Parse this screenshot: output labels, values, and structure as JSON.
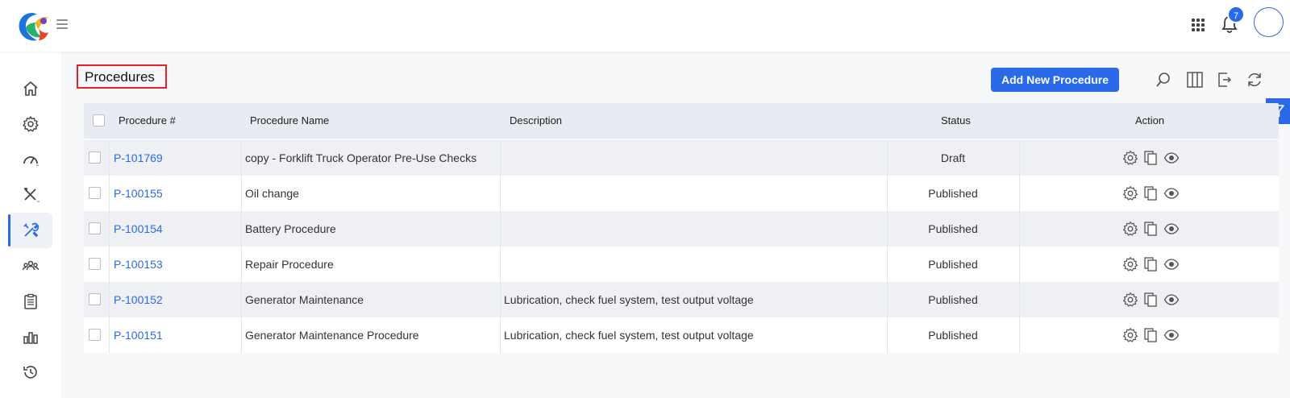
{
  "header": {
    "notification_count": "7",
    "icons": [
      "logo",
      "hamburger-icon",
      "apps-grid-icon",
      "bell-icon",
      "avatar"
    ]
  },
  "sidebar": {
    "items": [
      {
        "name": "home-icon",
        "active": false
      },
      {
        "name": "gear-icon",
        "active": false
      },
      {
        "name": "gauge-icon",
        "active": false
      },
      {
        "name": "tools-icon",
        "active": false
      },
      {
        "name": "procedures-icon",
        "active": true
      },
      {
        "name": "team-icon",
        "active": false
      },
      {
        "name": "clipboard-icon",
        "active": false
      },
      {
        "name": "bar-chart-icon",
        "active": false
      },
      {
        "name": "history-icon",
        "active": false
      }
    ]
  },
  "page": {
    "title": "Procedures",
    "add_button": "Add New Procedure",
    "toolbar_icons": [
      "search-icon",
      "columns-icon",
      "export-icon",
      "refresh-icon",
      "filter-icon"
    ]
  },
  "table": {
    "columns": [
      "Procedure #",
      "Procedure Name",
      "Description",
      "Status",
      "Action"
    ],
    "rows": [
      {
        "id": "P-101769",
        "name": "copy - Forklift Truck Operator Pre-Use Checks",
        "description": "",
        "status": "Draft"
      },
      {
        "id": "P-100155",
        "name": "Oil change",
        "description": "",
        "status": "Published"
      },
      {
        "id": "P-100154",
        "name": "Battery Procedure",
        "description": "",
        "status": "Published"
      },
      {
        "id": "P-100153",
        "name": "Repair Procedure",
        "description": "",
        "status": "Published"
      },
      {
        "id": "P-100152",
        "name": "Generator Maintenance",
        "description": "Lubrication, check fuel system, test output voltage",
        "status": "Published"
      },
      {
        "id": "P-100151",
        "name": "Generator Maintenance Procedure",
        "description": "Lubrication, check fuel system, test output voltage",
        "status": "Published"
      }
    ]
  },
  "colors": {
    "accent": "#2a6ae8",
    "highlight_border": "#e8202a"
  }
}
